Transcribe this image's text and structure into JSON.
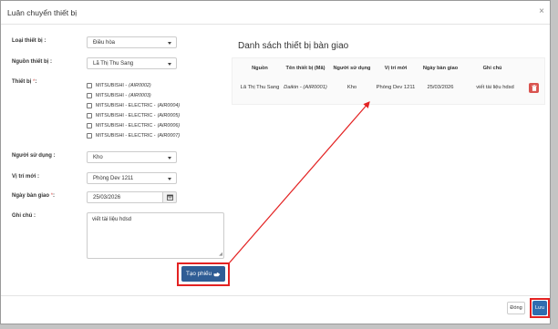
{
  "modal": {
    "title": "Luân chuyển thiết bị",
    "close_glyph": "×"
  },
  "form": {
    "device_type": {
      "label": "Loại thiết bị :",
      "value": "Điều hòa"
    },
    "device_source": {
      "label": "Nguồn thiết bị :",
      "value": "Lã Thị Thu Sang"
    },
    "devices": {
      "label": "Thiết bị",
      "required_mark": "*",
      "label_suffix": ":",
      "items": [
        {
          "name": "MITSUBISHI -",
          "code": "(AIR0002)"
        },
        {
          "name": "MITSUBISHI -",
          "code": "(AIR0003)"
        },
        {
          "name": "MITSUBISHI - ELECTRIC -",
          "code": "(AIR0004)"
        },
        {
          "name": "MITSUBISHI - ELECTRIC -",
          "code": "(AIR0005)"
        },
        {
          "name": "MITSUBISHI - ELECTRIC -",
          "code": "(AIR0006)"
        },
        {
          "name": "MITSUBISHI - ELECTRIC -",
          "code": "(AIR0007)"
        }
      ]
    },
    "user": {
      "label": "Người sử dụng :",
      "value": "Kho"
    },
    "new_location": {
      "label": "Vị trí mới :",
      "value": "Phòng Dev 1211"
    },
    "handover_date": {
      "label": "Ngày bàn giao",
      "required_mark": "*",
      "label_suffix": ":",
      "value": "25/03/2026"
    },
    "note": {
      "label": "Ghi chú :",
      "value": "viết tài liệu hdsd"
    },
    "create_button": "Tạo phiếu"
  },
  "handover_list": {
    "title": "Danh sách thiết bị bàn giao",
    "columns": [
      "Nguồn",
      "Tên thiết bị (Mã)",
      "Người sử dụng",
      "Vị trí mới",
      "Ngày bàn giao",
      "Ghi chú"
    ],
    "rows": [
      {
        "source": "Lã Thị Thu Sang",
        "device_name": "Daikin -",
        "device_code": "(AIR0001)",
        "user": "Kho",
        "new_location": "Phòng Dev 1211",
        "date": "25/03/2026",
        "note": "viết tài liệu hdsd"
      }
    ]
  },
  "footer": {
    "close_button": "Đóng",
    "save_button": "Lưu"
  },
  "colors": {
    "primary": "#2f5d95",
    "danger": "#d9534f",
    "highlight": "#e32222"
  }
}
